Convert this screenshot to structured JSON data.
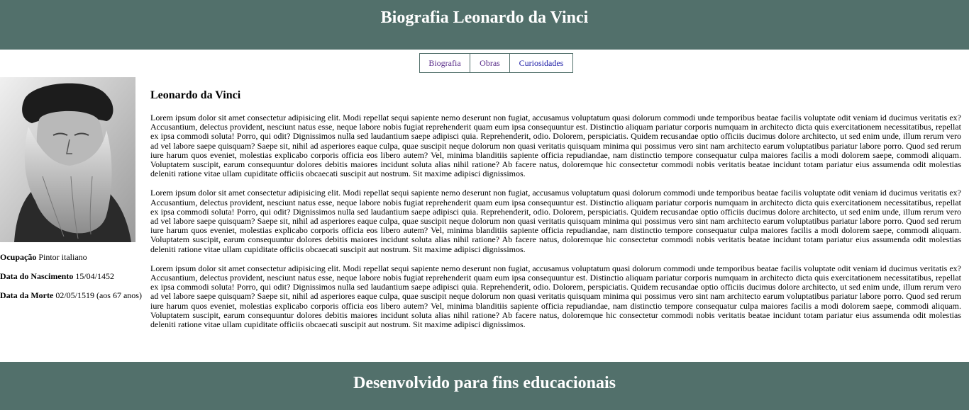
{
  "header": {
    "title": "Biografia Leonardo da Vinci"
  },
  "nav": {
    "items": [
      {
        "label": "Biografia"
      },
      {
        "label": "Obras"
      },
      {
        "label": "Curiosidades"
      }
    ]
  },
  "sidebar": {
    "portrait_alt": "Retrato de Leonardo da Vinci",
    "facts": [
      {
        "label": "Ocupação",
        "value": " Pintor italiano"
      },
      {
        "label": "Data do Nascimento",
        "value": " 15/04/1452"
      },
      {
        "label": "Data da Morte",
        "value": " 02/05/1519 (aos 67 anos)"
      }
    ]
  },
  "main": {
    "heading": "Leonardo da Vinci",
    "paragraphs": [
      "Lorem ipsum dolor sit amet consectetur adipisicing elit. Modi repellat sequi sapiente nemo deserunt non fugiat, accusamus voluptatum quasi dolorum commodi unde temporibus beatae facilis voluptate odit veniam id ducimus veritatis ex? Accusantium, delectus provident, nesciunt natus esse, neque labore nobis fugiat reprehenderit quam eum ipsa consequuntur est. Distinctio aliquam pariatur corporis numquam in architecto dicta quis exercitationem necessitatibus, repellat ex ipsa commodi soluta! Porro, qui odit? Dignissimos nulla sed laudantium saepe adipisci quia. Reprehenderit, odio. Dolorem, perspiciatis. Quidem recusandae optio officiis ducimus dolore architecto, ut sed enim unde, illum rerum vero ad vel labore saepe quisquam? Saepe sit, nihil ad asperiores eaque culpa, quae suscipit neque dolorum non quasi veritatis quisquam minima qui possimus vero sint nam architecto earum voluptatibus pariatur labore porro. Quod sed rerum iure harum quos eveniet, molestias explicabo corporis officia eos libero autem? Vel, minima blanditiis sapiente officia repudiandae, nam distinctio tempore consequatur culpa maiores facilis a modi dolorem saepe, commodi aliquam. Voluptatem suscipit, earum consequuntur dolores debitis maiores incidunt soluta alias nihil ratione? Ab facere natus, doloremque hic consectetur commodi nobis veritatis beatae incidunt totam pariatur eius assumenda odit molestias deleniti ratione vitae ullam cupiditate officiis obcaecati suscipit aut nostrum. Sit maxime adipisci dignissimos.",
      "Lorem ipsum dolor sit amet consectetur adipisicing elit. Modi repellat sequi sapiente nemo deserunt non fugiat, accusamus voluptatum quasi dolorum commodi unde temporibus beatae facilis voluptate odit veniam id ducimus veritatis ex? Accusantium, delectus provident, nesciunt natus esse, neque labore nobis fugiat reprehenderit quam eum ipsa consequuntur est. Distinctio aliquam pariatur corporis numquam in architecto dicta quis exercitationem necessitatibus, repellat ex ipsa commodi soluta! Porro, qui odit? Dignissimos nulla sed laudantium saepe adipisci quia. Reprehenderit, odio. Dolorem, perspiciatis. Quidem recusandae optio officiis ducimus dolore architecto, ut sed enim unde, illum rerum vero ad vel labore saepe quisquam? Saepe sit, nihil ad asperiores eaque culpa, quae suscipit neque dolorum non quasi veritatis quisquam minima qui possimus vero sint nam architecto earum voluptatibus pariatur labore porro. Quod sed rerum iure harum quos eveniet, molestias explicabo corporis officia eos libero autem? Vel, minima blanditiis sapiente officia repudiandae, nam distinctio tempore consequatur culpa maiores facilis a modi dolorem saepe, commodi aliquam. Voluptatem suscipit, earum consequuntur dolores debitis maiores incidunt soluta alias nihil ratione? Ab facere natus, doloremque hic consectetur commodi nobis veritatis beatae incidunt totam pariatur eius assumenda odit molestias deleniti ratione vitae ullam cupiditate officiis obcaecati suscipit aut nostrum. Sit maxime adipisci dignissimos.",
      "Lorem ipsum dolor sit amet consectetur adipisicing elit. Modi repellat sequi sapiente nemo deserunt non fugiat, accusamus voluptatum quasi dolorum commodi unde temporibus beatae facilis voluptate odit veniam id ducimus veritatis ex? Accusantium, delectus provident, nesciunt natus esse, neque labore nobis fugiat reprehenderit quam eum ipsa consequuntur est. Distinctio aliquam pariatur corporis numquam in architecto dicta quis exercitationem necessitatibus, repellat ex ipsa commodi soluta! Porro, qui odit? Dignissimos nulla sed laudantium saepe adipisci quia. Reprehenderit, odio. Dolorem, perspiciatis. Quidem recusandae optio officiis ducimus dolore architecto, ut sed enim unde, illum rerum vero ad vel labore saepe quisquam? Saepe sit, nihil ad asperiores eaque culpa, quae suscipit neque dolorum non quasi veritatis quisquam minima qui possimus vero sint nam architecto earum voluptatibus pariatur labore porro. Quod sed rerum iure harum quos eveniet, molestias explicabo corporis officia eos libero autem? Vel, minima blanditiis sapiente officia repudiandae, nam distinctio tempore consequatur culpa maiores facilis a modi dolorem saepe, commodi aliquam. Voluptatem suscipit, earum consequuntur dolores debitis maiores incidunt soluta alias nihil ratione? Ab facere natus, doloremque hic consectetur commodi nobis veritatis beatae incidunt totam pariatur eius assumenda odit molestias deleniti ratione vitae ullam cupiditate officiis obcaecati suscipit aut nostrum. Sit maxime adipisci dignissimos."
    ]
  },
  "footer": {
    "text": "Desenvolvido para fins educacionais"
  },
  "colors": {
    "header_bg": "#52706b",
    "visited_link": "#5a2d8a",
    "link": "#1a1aa6"
  }
}
